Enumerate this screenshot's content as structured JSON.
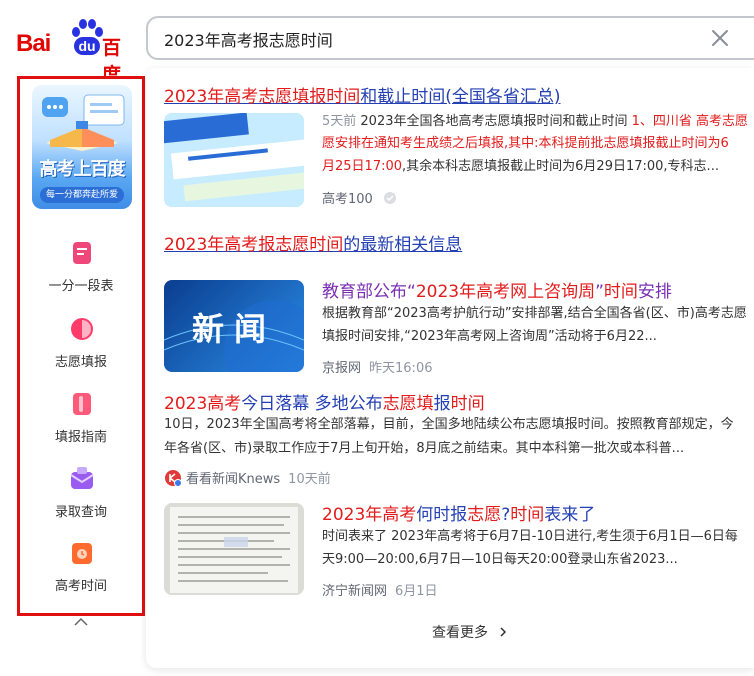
{
  "logo": {
    "latin": "Bai",
    "du": "du",
    "chinese": "百度"
  },
  "search": {
    "query": "2023年高考报志愿时间"
  },
  "sidebar": {
    "banner_title": "高考上百度",
    "banner_subtitle": "每一分都奔赴所爱",
    "items": [
      {
        "label": "一分一段表",
        "color": "#f0477a"
      },
      {
        "label": "志愿填报",
        "color": "#ff3b6b"
      },
      {
        "label": "填报指南",
        "color": "#ff5a7a"
      },
      {
        "label": "录取查询",
        "color": "#9a5cf0"
      },
      {
        "label": "高考时间",
        "color": "#ff6a2e"
      }
    ]
  },
  "result1": {
    "title_hl": "2023年高考志愿填报时间",
    "title_rest": "和截止时间(全国各省汇总)",
    "date": "5天前",
    "line1_a": " 2023年全国各地高考志愿填报时间和截止时间 ",
    "line1_b": "1、四川省 高考志愿",
    "line2": "愿安排在通知考生成绩之后填报,其中:本科提前批志愿填报截止时间为6",
    "line3_a": "月25日17:00",
    "line3_b": ",其余本科志愿填报截止时间为6月29日17:00,专科志...",
    "source": "高考100"
  },
  "news_heading": {
    "hl": "2023年高考报志愿时间",
    "rest": "的最新相关信息"
  },
  "news1": {
    "thumb_text": "新闻",
    "title_a": "教育部公布“",
    "title_hl": "2023年高考网上咨询周",
    "title_b": "”",
    "title_hl2": "时间",
    "title_c": "安排",
    "line1": "根据教育部“2023高考护航行动”安排部署,结合全国各省(区、市)高考志愿",
    "line2": "填报时间安排,“2023年高考网上咨询周”活动将于6月22...",
    "source": "京报网",
    "time": "昨天16:06"
  },
  "news2": {
    "title_hl": "2023高考",
    "title_a": "今日落幕 多地公布",
    "title_hl2": "志愿填",
    "title_b": "报",
    "title_hl3": "时间",
    "line1": "10日，2023年全国高考将全部落幕，目前，全国多地陆续公布志愿填报时间。按照教育部规定，今",
    "line2": "年各省(区、市)录取工作应于7月上旬开始，8月底之前结束。其中本科第一批次或本科普...",
    "source": "看看新闻Knews",
    "time": "10天前"
  },
  "news3": {
    "title_hl": "2023年高考",
    "title_a": "何时报",
    "title_hl2": "志愿",
    "title_b": "?",
    "title_hl3": "时间",
    "title_c": "表来了",
    "line1": "时间表来了 2023年高考将于6月7日-10日进行,考生须于6月1日—6日每",
    "line2": "天9:00—20:00,6月7日—10日每天20:00登录山东省2023...",
    "source": "济宁新闻网",
    "time": "6月1日"
  },
  "more": {
    "label": "查看更多"
  }
}
